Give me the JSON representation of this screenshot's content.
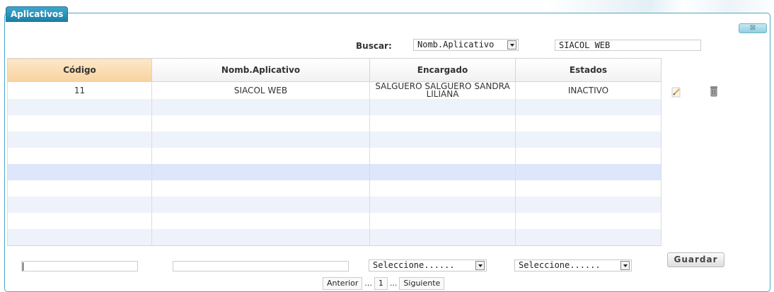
{
  "panel": {
    "title": "Aplicativos",
    "close_label": "⊠"
  },
  "search": {
    "label": "Buscar:",
    "field_value": "Nomb.Aplicativo",
    "value": "SIACOL WEB"
  },
  "table": {
    "columns": [
      "Código",
      "Nomb.Aplicativo",
      "Encargado",
      "Estados"
    ],
    "rows": [
      {
        "codigo": "11",
        "nombre": "SIACOL WEB",
        "encargado": "SALGUERO SALGUERO SANDRA LILIANA",
        "estado": "INACTIVO"
      }
    ]
  },
  "form": {
    "codigo_value": "",
    "nombre_value": "",
    "encargado_select": "Seleccione......",
    "estado_select": "Seleccione......",
    "save_label": "Guardar"
  },
  "pager": {
    "prev": "Anterior",
    "dots": "...",
    "page": "1",
    "next": "Siguiente"
  }
}
